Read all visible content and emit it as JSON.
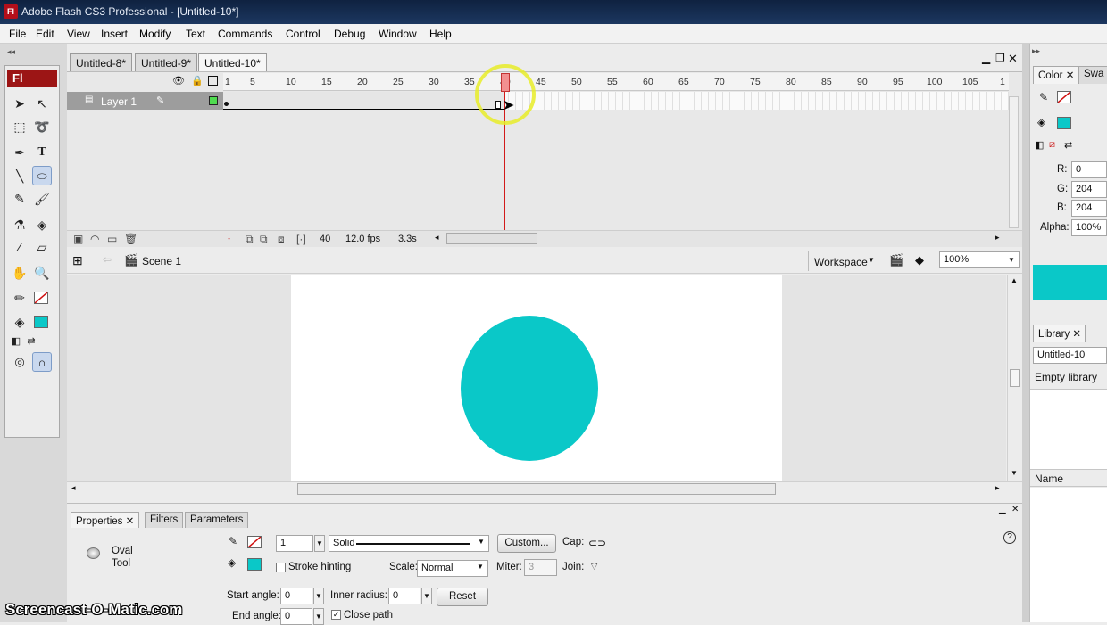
{
  "window": {
    "title": "Adobe Flash CS3 Professional - [Untitled-10*]",
    "app_icon": "Fl"
  },
  "menu": [
    "File",
    "Edit",
    "View",
    "Insert",
    "Modify",
    "Text",
    "Commands",
    "Control",
    "Debug",
    "Window",
    "Help"
  ],
  "doc_tabs": [
    "Untitled-8*",
    "Untitled-9*",
    "Untitled-10*"
  ],
  "toolbox": {
    "badge": "Fl"
  },
  "timeline": {
    "ruler": [
      "1",
      "5",
      "10",
      "15",
      "20",
      "25",
      "30",
      "35",
      "40",
      "45",
      "50",
      "55",
      "60",
      "65",
      "70",
      "75",
      "80",
      "85",
      "90",
      "95",
      "100",
      "105",
      "1"
    ],
    "layer_name": "Layer 1",
    "current_frame": "40",
    "fps": "12.0 fps",
    "elapsed": "3.3s"
  },
  "scene": {
    "name": "Scene 1",
    "workspace_label": "Workspace",
    "zoom": "100%"
  },
  "stage": {
    "shape_color": "#0ac8c8"
  },
  "properties": {
    "tabs": [
      "Properties",
      "Filters",
      "Parameters"
    ],
    "tool_line1": "Oval",
    "tool_line2": "Tool",
    "stroke_height": "1",
    "stroke_style": "Solid",
    "custom_button": "Custom...",
    "cap_label": "Cap:",
    "stroke_hinting": "Stroke hinting",
    "scale_label": "Scale:",
    "scale_value": "Normal",
    "miter_label": "Miter:",
    "miter_value": "3",
    "join_label": "Join:",
    "start_angle_label": "Start angle:",
    "start_angle": "0",
    "inner_radius_label": "Inner radius:",
    "inner_radius": "0",
    "reset_button": "Reset",
    "end_angle_label": "End angle:",
    "end_angle": "0",
    "close_path": "Close path"
  },
  "color_panel": {
    "tabs": [
      "Color",
      "Swa"
    ],
    "r_label": "R:",
    "r": "0",
    "g_label": "G:",
    "g": "204",
    "b_label": "B:",
    "b": "204",
    "alpha_label": "Alpha:",
    "alpha": "100%",
    "fill_color": "#0ac8c8"
  },
  "library_panel": {
    "tab": "Library",
    "document": "Untitled-10",
    "status": "Empty library",
    "name_header": "Name"
  },
  "watermark": "Screencast-O-Matic.com"
}
